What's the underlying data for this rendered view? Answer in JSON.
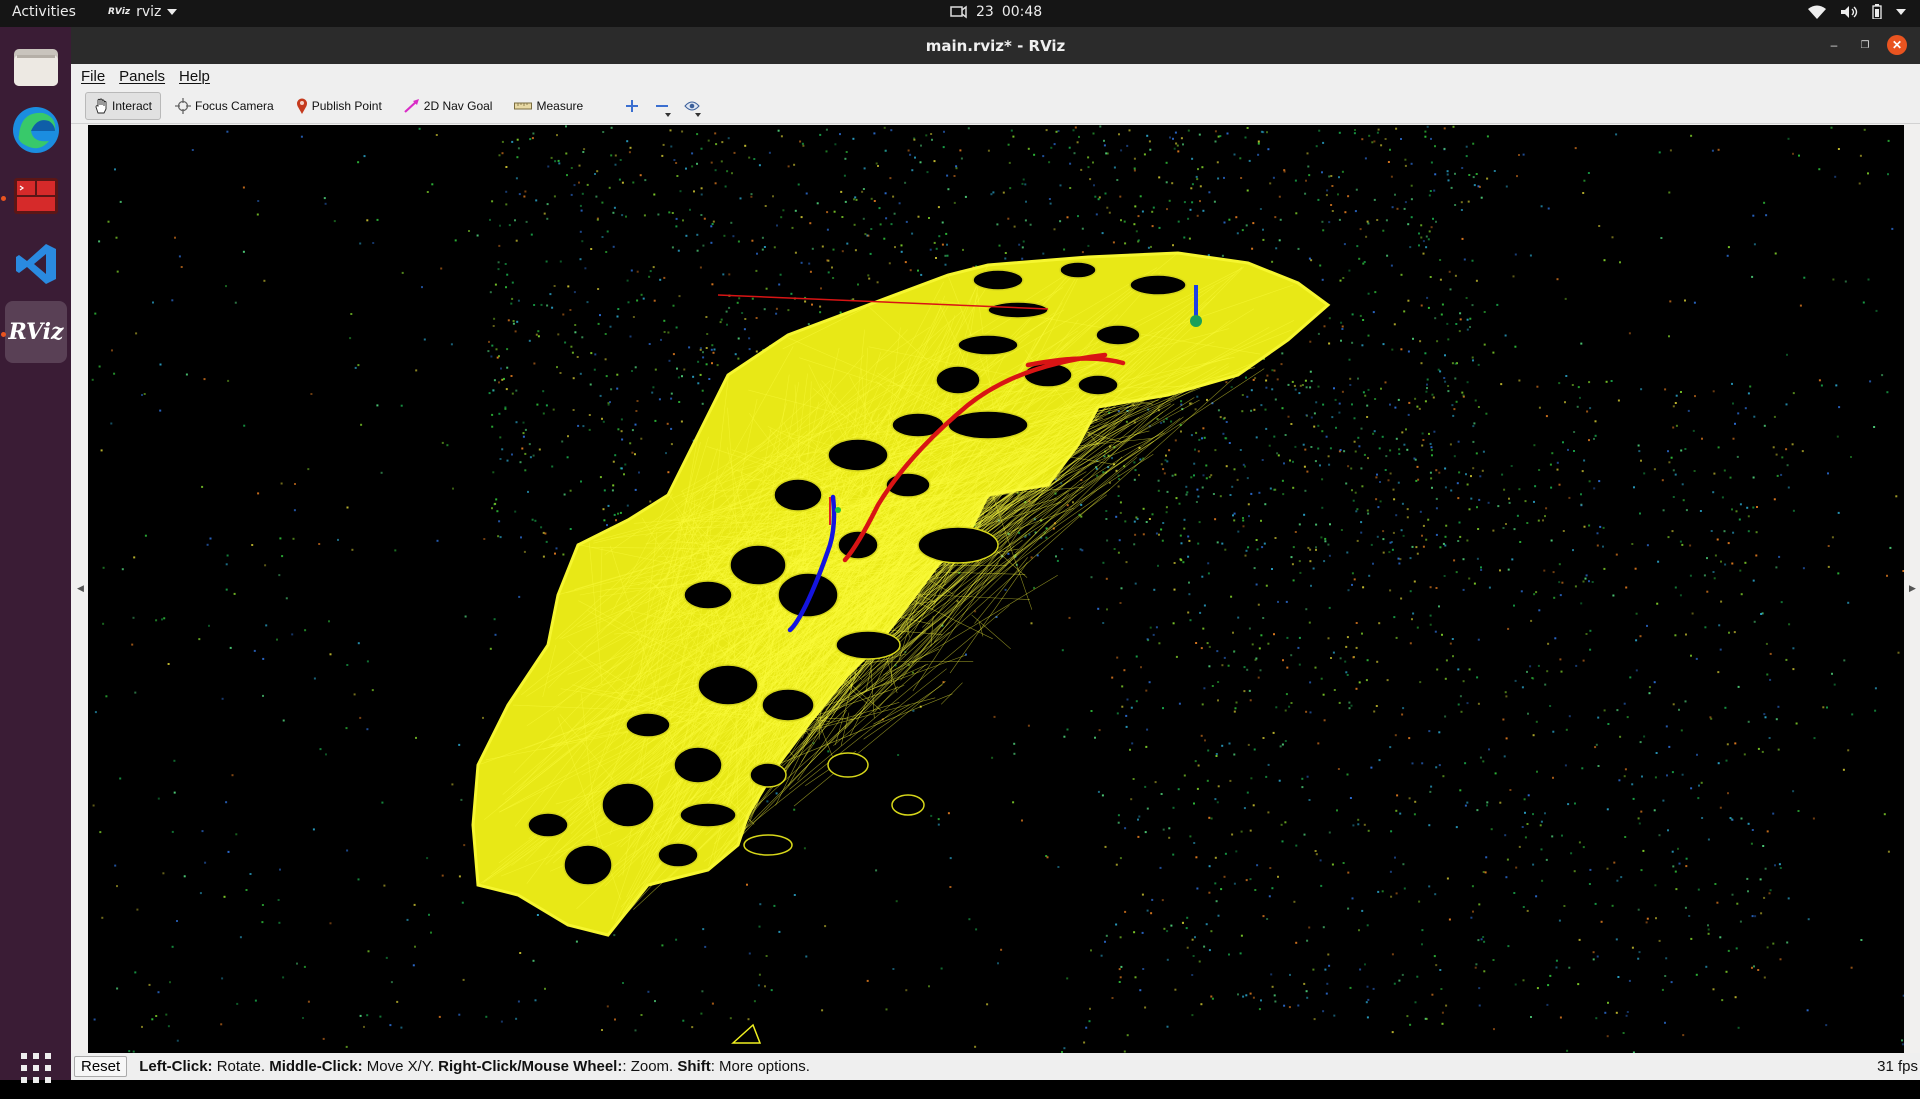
{
  "topbar": {
    "activities": "Activities",
    "app_name": "rviz",
    "app_badge": "RViz",
    "date": "23",
    "time": "00:48"
  },
  "dock": {
    "items": [
      {
        "name": "files",
        "icon": "folder-icon"
      },
      {
        "name": "edge",
        "icon": "edge-icon"
      },
      {
        "name": "terminator",
        "icon": "terminal-icon"
      },
      {
        "name": "vscode",
        "icon": "vscode-icon"
      },
      {
        "name": "rviz",
        "icon": "rviz-icon",
        "label": "RViz"
      }
    ],
    "show_apps_icon": "grid-icon"
  },
  "window": {
    "title": "main.rviz* - RViz"
  },
  "menu": {
    "file": "File",
    "panels": "Panels",
    "help": "Help"
  },
  "toolbar": {
    "interact": "Interact",
    "focus_camera": "Focus Camera",
    "publish_point": "Publish Point",
    "nav_goal": "2D Nav Goal",
    "measure": "Measure"
  },
  "status": {
    "reset": "Reset",
    "left_click_key": "Left-Click:",
    "left_click_val": " Rotate. ",
    "middle_click_key": "Middle-Click:",
    "middle_click_val": " Move X/Y. ",
    "right_click_key": "Right-Click/Mouse Wheel:",
    "right_click_val": ": Zoom. ",
    "shift_key": "Shift",
    "shift_val": ": More options.",
    "fps": "31 fps"
  },
  "colors": {
    "mesh": "#f2f21a",
    "path_red": "#d81414",
    "path_blue": "#1414e0",
    "accent": "#e95420"
  }
}
